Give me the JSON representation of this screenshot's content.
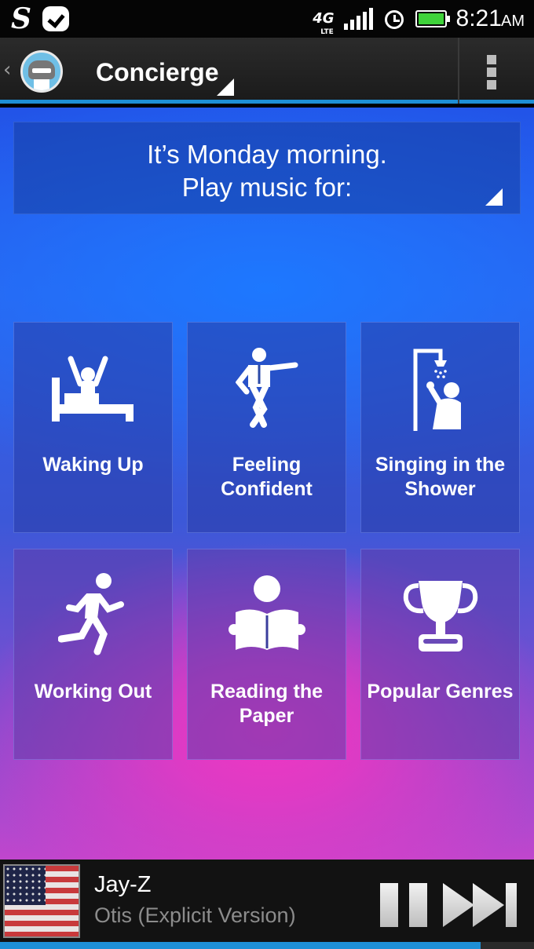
{
  "status_bar": {
    "network": "4G",
    "network_sub": "LTE",
    "time": "8:21",
    "ampm": "AM",
    "icons": [
      "s-app-icon",
      "message-check-icon",
      "lte-icon",
      "signal-icon",
      "alarm-icon",
      "battery-icon"
    ]
  },
  "action_bar": {
    "title": "Concierge",
    "icons": [
      "back-chevron-icon",
      "app-logo-icon",
      "dropdown-triangle-icon",
      "overflow-menu-icon"
    ]
  },
  "prompt": {
    "line1": "It’s Monday morning.",
    "line2": "Play music for:"
  },
  "tiles": [
    {
      "label_lines": [
        "Waking Up"
      ],
      "icon": "waking-up-icon"
    },
    {
      "label_lines": [
        "Feeling",
        "Confident"
      ],
      "icon": "confident-icon"
    },
    {
      "label_lines": [
        "Singing in the",
        "Shower"
      ],
      "icon": "shower-icon"
    },
    {
      "label_lines": [
        "Working Out"
      ],
      "icon": "running-icon"
    },
    {
      "label_lines": [
        "Reading the",
        "Paper"
      ],
      "icon": "reading-icon"
    },
    {
      "label_lines": [
        "Popular Genres"
      ],
      "icon": "trophy-icon"
    }
  ],
  "now_playing": {
    "artist": "Jay-Z",
    "title": "Otis (Explicit Version)",
    "progress": 0.9,
    "icons": [
      "album-art",
      "pause-icon",
      "next-icon"
    ]
  },
  "colors": {
    "accent": "#1e8fd6",
    "background_top": "#2254e8",
    "background_glow": "#f236c2"
  }
}
